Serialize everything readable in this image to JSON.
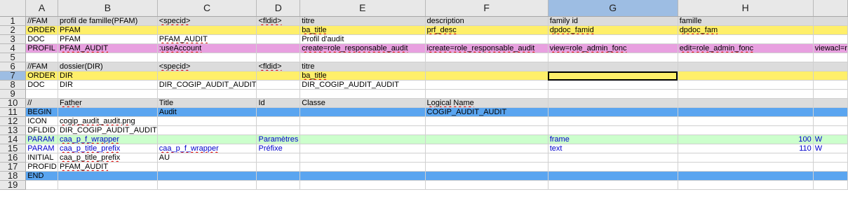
{
  "columns": [
    "A",
    "B",
    "C",
    "D",
    "E",
    "F",
    "G",
    "H"
  ],
  "rows": [
    {
      "n": "1",
      "style": "gray",
      "cells": [
        "//FAM",
        "profil de famille(PFAM)",
        "<specid>",
        "<fldid>",
        "titre",
        "description",
        "family id",
        "famille",
        ""
      ]
    },
    {
      "n": "2",
      "style": "yellow",
      "cells": [
        "ORDER",
        "PFAM",
        "",
        "",
        "ba_title",
        "prf_desc",
        "dpdoc_famid",
        "dpdoc_fam",
        ""
      ]
    },
    {
      "n": "3",
      "style": "",
      "cells": [
        "DOC",
        "PFAM",
        "PFAM_AUDIT",
        "",
        "Profil d'audit",
        "",
        "",
        "",
        ""
      ]
    },
    {
      "n": "4",
      "style": "pink",
      "cells": [
        "PROFIL",
        "PFAM_AUDIT",
        ":useAccount",
        "",
        "create=role_responsable_audit",
        "icreate=role_responsable_audit",
        "view=role_admin_fonc",
        "edit=role_admin_fonc",
        "viewacl=r"
      ]
    },
    {
      "n": "5",
      "style": "",
      "cells": [
        "",
        "",
        "",
        "",
        "",
        "",
        "",
        "",
        ""
      ]
    },
    {
      "n": "6",
      "style": "gray",
      "cells": [
        "//FAM",
        "dossier(DIR)",
        "<specid>",
        "<fldid>",
        "titre",
        "",
        "",
        "",
        ""
      ]
    },
    {
      "n": "7",
      "style": "yellow",
      "cells": [
        "ORDER",
        "DIR",
        "",
        "",
        "ba_title",
        "",
        "",
        "",
        ""
      ]
    },
    {
      "n": "8",
      "style": "",
      "cells": [
        "DOC",
        "DIR",
        "DIR_COGIP_AUDIT_AUDIT",
        "",
        "DIR_COGIP_AUDIT_AUDIT",
        "",
        "",
        "",
        ""
      ]
    },
    {
      "n": "9",
      "style": "",
      "cells": [
        "",
        "",
        "",
        "",
        "",
        "",
        "",
        "",
        ""
      ]
    },
    {
      "n": "10",
      "style": "gray",
      "cells": [
        "//",
        "Father",
        "Title",
        "Id",
        "Classe",
        "Logical Name",
        "",
        "",
        ""
      ]
    },
    {
      "n": "11",
      "style": "blue",
      "cells": [
        "BEGIN",
        "",
        "Audit",
        "",
        "",
        "COGIP_AUDIT_AUDIT",
        "",
        "",
        ""
      ]
    },
    {
      "n": "12",
      "style": "",
      "cells": [
        "ICON",
        "cogip_audit_audit.png",
        "",
        "",
        "",
        "",
        "",
        "",
        ""
      ]
    },
    {
      "n": "13",
      "style": "",
      "cells": [
        "DFLDID",
        "DIR_COGIP_AUDIT_AUDIT",
        "",
        "",
        "",
        "",
        "",
        "",
        ""
      ]
    },
    {
      "n": "14",
      "style": "green",
      "cells": [
        "PARAM",
        "caa_p_f_wrapper",
        "",
        "Paramètres",
        "",
        "",
        "frame",
        "100",
        "W"
      ]
    },
    {
      "n": "15",
      "style": "",
      "cells": [
        "PARAM",
        "caa_p_title_prefix",
        "caa_p_f_wrapper",
        "Préfixe",
        "",
        "",
        "text",
        "110",
        "W"
      ]
    },
    {
      "n": "16",
      "style": "",
      "cells": [
        "INITIAL",
        "caa_p_title_prefix",
        "AU",
        "",
        "",
        "",
        "",
        "",
        ""
      ]
    },
    {
      "n": "17",
      "style": "",
      "cells": [
        "PROFID",
        "PFAM_AUDIT",
        "",
        "",
        "",
        "",
        "",
        "",
        ""
      ]
    },
    {
      "n": "18",
      "style": "blue",
      "cells": [
        "END",
        "",
        "",
        "",
        "",
        "",
        "",
        "",
        ""
      ]
    },
    {
      "n": "19",
      "style": "",
      "cells": [
        "",
        "",
        "",
        "",
        "",
        "",
        "",
        "",
        ""
      ]
    }
  ],
  "selected": {
    "row": "7",
    "col": "G"
  },
  "colors": {
    "header_selected": "#9dbde3",
    "yellow": "#ffef6a",
    "pink": "#e8a0e0",
    "blue": "#5aa5f0",
    "green": "#ccffcc"
  }
}
